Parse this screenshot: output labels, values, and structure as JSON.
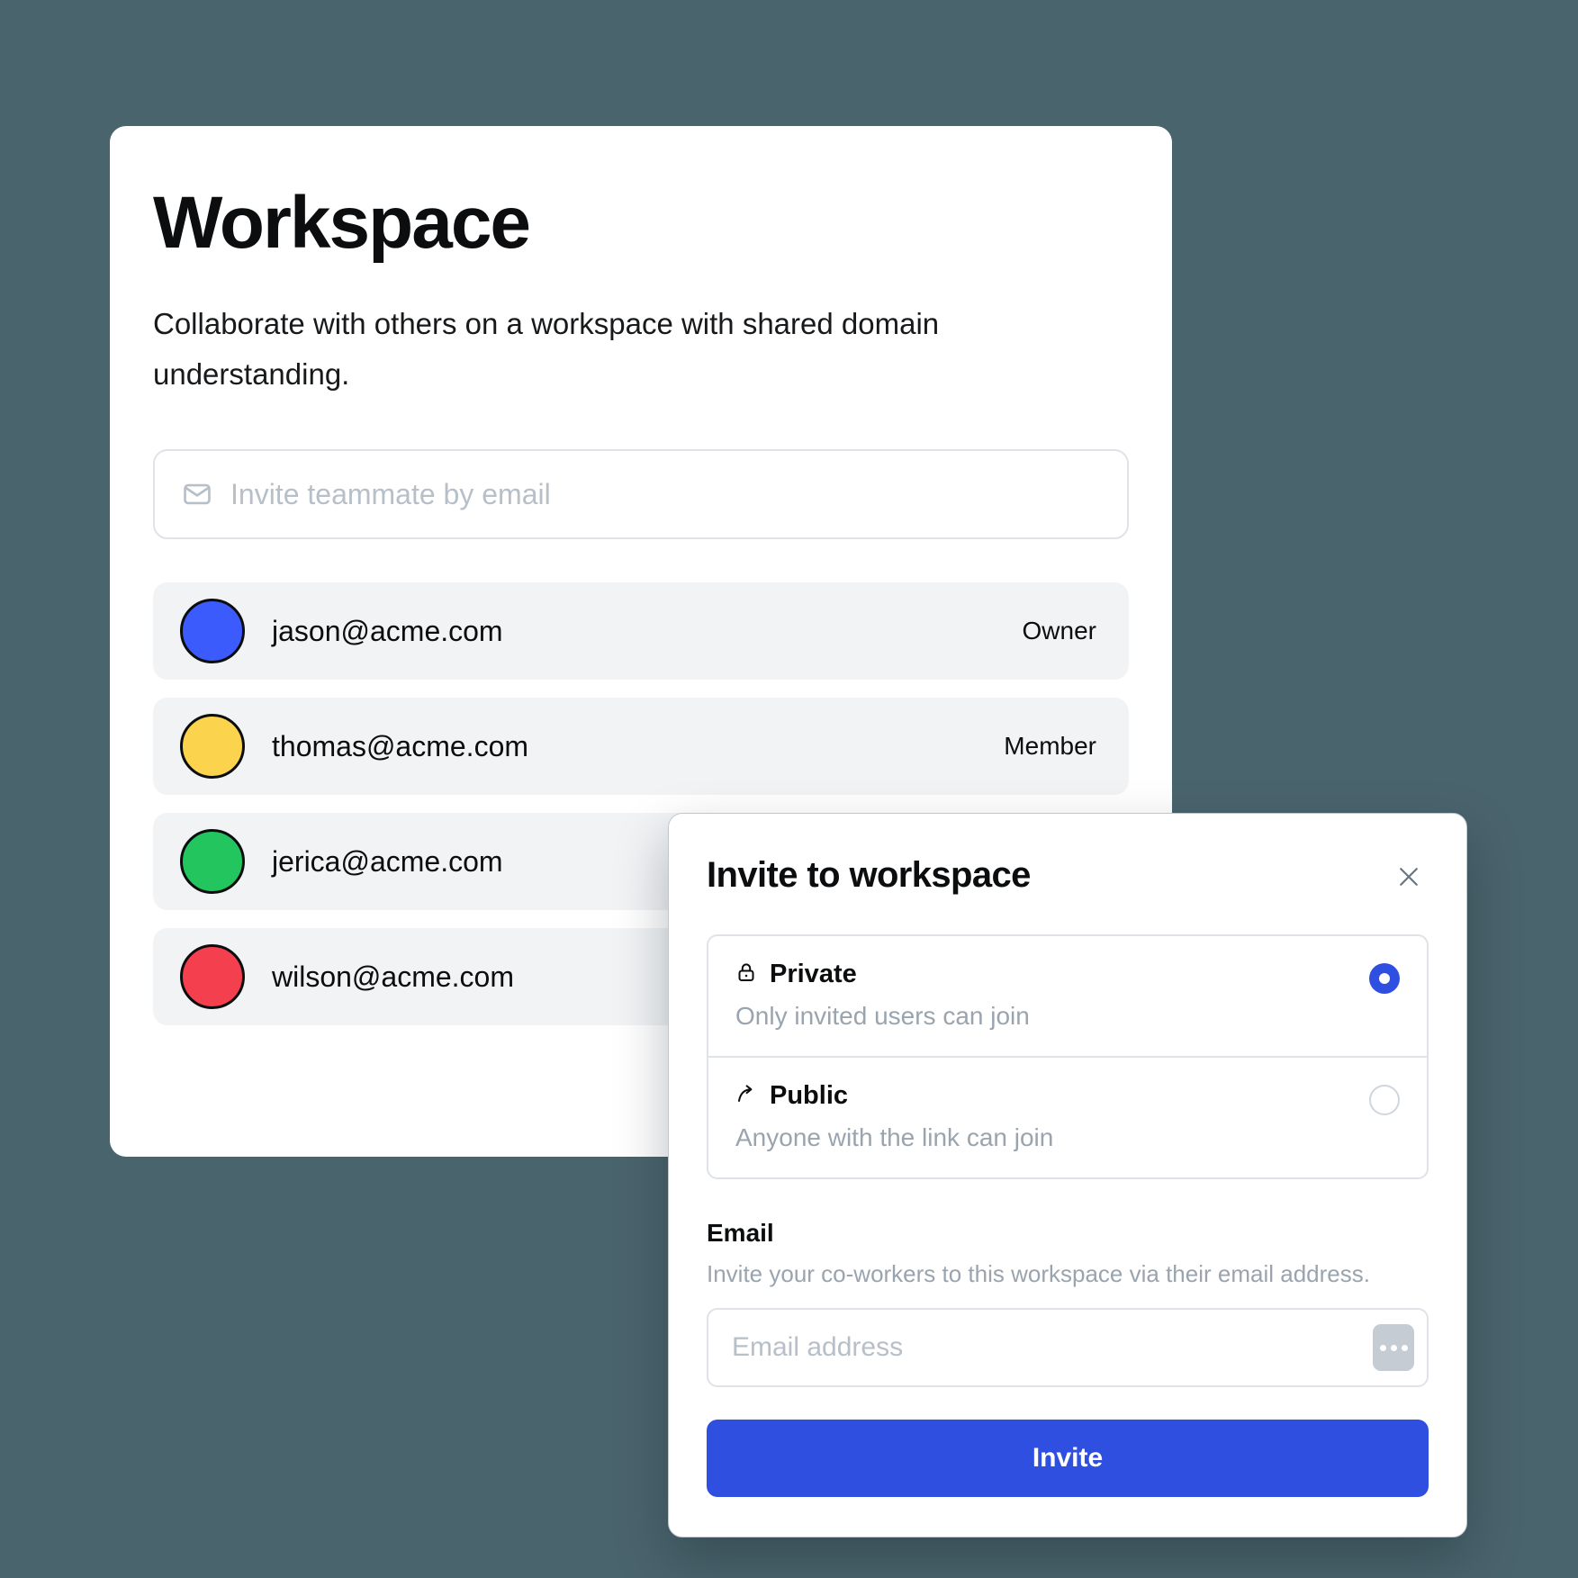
{
  "theme": {
    "background": "#4a646d",
    "accent": "#2f4fe0",
    "card_bg": "#ffffff",
    "row_bg": "#f1f3f5",
    "muted_text": "#9aa4ae"
  },
  "workspace": {
    "title": "Workspace",
    "subtitle": "Collaborate with others on a workspace with shared domain understanding.",
    "invite_input": {
      "icon": "mail-icon",
      "placeholder": "Invite teammate by email",
      "value": ""
    },
    "members": [
      {
        "email": "jason@acme.com",
        "role": "Owner",
        "avatar_color": "#3b5bfc"
      },
      {
        "email": "thomas@acme.com",
        "role": "Member",
        "avatar_color": "#fcd34d"
      },
      {
        "email": "jerica@acme.com",
        "role": "",
        "avatar_color": "#22c55e"
      },
      {
        "email": "wilson@acme.com",
        "role": "",
        "avatar_color": "#f43f4e"
      }
    ]
  },
  "modal": {
    "title": "Invite to workspace",
    "close_icon": "close-icon",
    "options": [
      {
        "icon": "lock-icon",
        "label": "Private",
        "description": "Only invited users can join",
        "selected": true
      },
      {
        "icon": "share-icon",
        "label": "Public",
        "description": "Anyone with the link can join",
        "selected": false
      }
    ],
    "email_section": {
      "label": "Email",
      "help": "Invite your co-workers to this workspace via their email address.",
      "placeholder": "Email address",
      "value": "",
      "more_icon": "ellipsis-icon"
    },
    "submit_label": "Invite"
  }
}
